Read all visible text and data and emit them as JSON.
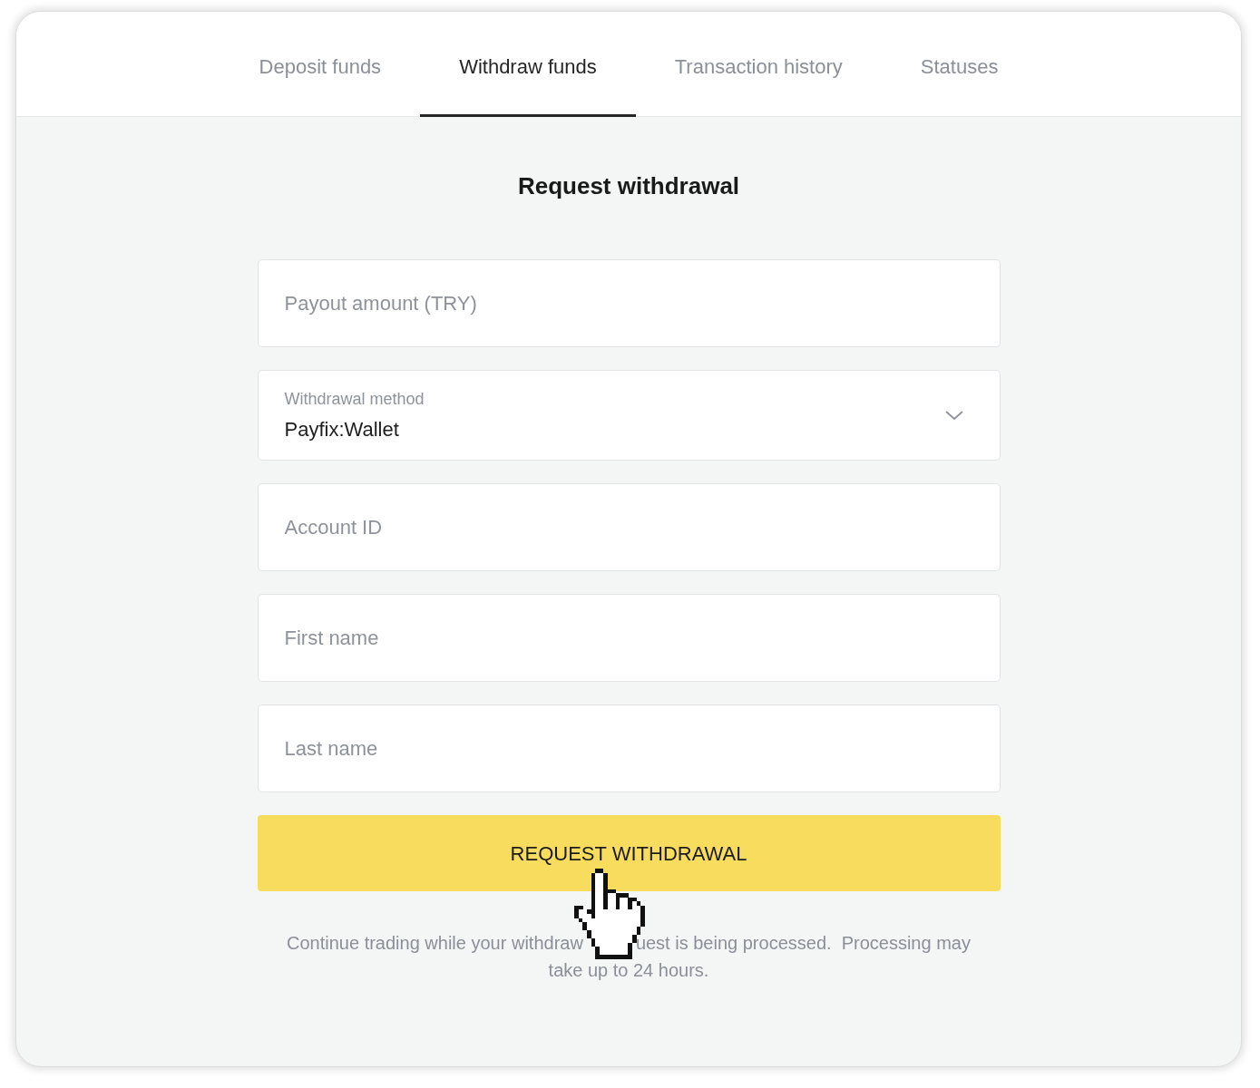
{
  "tabs": [
    {
      "label": "Deposit funds",
      "selected": false
    },
    {
      "label": "Withdraw funds",
      "selected": true
    },
    {
      "label": "Transaction history",
      "selected": false
    },
    {
      "label": "Statuses",
      "selected": false
    }
  ],
  "title": "Request withdrawal",
  "fields": [
    {
      "kind": "input",
      "placeholder": "Payout amount (TRY)"
    },
    {
      "kind": "select",
      "label": "Withdrawal method",
      "value": "Payfix:Wallet"
    },
    {
      "kind": "input",
      "placeholder": "Account ID"
    },
    {
      "kind": "input",
      "placeholder": "First name"
    },
    {
      "kind": "input",
      "placeholder": "Last name"
    }
  ],
  "submit_button": "REQUEST WITHDRAWAL",
  "notice": {
    "before_cursor": "Continue trading while your withdraw",
    "after_cursor": "uest is being processed.  Processing may",
    "second_line": "take up to 24 hours."
  }
}
